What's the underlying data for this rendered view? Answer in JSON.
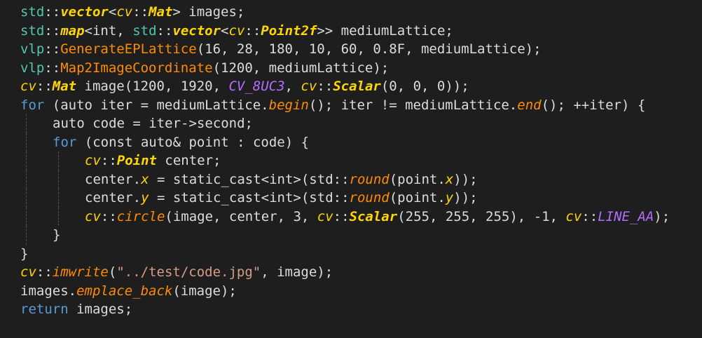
{
  "code_lines": [
    {
      "indent": 0,
      "tokens": [
        {
          "t": "std",
          "c": "ns"
        },
        {
          "t": "::",
          "c": "text"
        },
        {
          "t": "vector",
          "c": "type"
        },
        {
          "t": "<",
          "c": "text"
        },
        {
          "t": "cv",
          "c": "typedim"
        },
        {
          "t": "::",
          "c": "text"
        },
        {
          "t": "Mat",
          "c": "type"
        },
        {
          "t": "> images;",
          "c": "text"
        }
      ]
    },
    {
      "indent": 0,
      "tokens": [
        {
          "t": "std",
          "c": "ns"
        },
        {
          "t": "::",
          "c": "text"
        },
        {
          "t": "map",
          "c": "type"
        },
        {
          "t": "<int, ",
          "c": "text"
        },
        {
          "t": "std",
          "c": "ns"
        },
        {
          "t": "::",
          "c": "text"
        },
        {
          "t": "vector",
          "c": "type"
        },
        {
          "t": "<",
          "c": "text"
        },
        {
          "t": "cv",
          "c": "typedim"
        },
        {
          "t": "::",
          "c": "text"
        },
        {
          "t": "Point2f",
          "c": "type"
        },
        {
          "t": ">> mediumLattice;",
          "c": "text"
        }
      ]
    },
    {
      "indent": 0,
      "tokens": [
        {
          "t": "vlp",
          "c": "ns"
        },
        {
          "t": "::",
          "c": "text"
        },
        {
          "t": "GenerateEPLattice",
          "c": "fn"
        },
        {
          "t": "(16, 28, 180, 10, 60, 0.8F, mediumLattice);",
          "c": "text"
        }
      ]
    },
    {
      "indent": 0,
      "tokens": [
        {
          "t": "vlp",
          "c": "ns"
        },
        {
          "t": "::",
          "c": "text"
        },
        {
          "t": "Map2ImageCoordinate",
          "c": "fn"
        },
        {
          "t": "(1200, mediumLattice);",
          "c": "text"
        }
      ]
    },
    {
      "indent": 0,
      "tokens": [
        {
          "t": "cv",
          "c": "typedim"
        },
        {
          "t": "::",
          "c": "text"
        },
        {
          "t": "Mat",
          "c": "type"
        },
        {
          "t": " image(1200, 1920, ",
          "c": "text"
        },
        {
          "t": "CV_8UC3",
          "c": "macro"
        },
        {
          "t": ", ",
          "c": "text"
        },
        {
          "t": "cv",
          "c": "typedim"
        },
        {
          "t": "::",
          "c": "text"
        },
        {
          "t": "Scalar",
          "c": "type"
        },
        {
          "t": "(0, 0, 0));",
          "c": "text"
        }
      ]
    },
    {
      "indent": 0,
      "tokens": [
        {
          "t": "for",
          "c": "kw"
        },
        {
          "t": " (auto iter = mediumLattice.",
          "c": "text"
        },
        {
          "t": "begin",
          "c": "member"
        },
        {
          "t": "(); iter != mediumLattice.",
          "c": "text"
        },
        {
          "t": "end",
          "c": "member"
        },
        {
          "t": "(); ++iter) {",
          "c": "text"
        }
      ]
    },
    {
      "indent": 1,
      "tokens": [
        {
          "t": "auto code = iter->second;",
          "c": "text"
        }
      ]
    },
    {
      "indent": 1,
      "tokens": [
        {
          "t": "for",
          "c": "kw"
        },
        {
          "t": " (const auto& point : code) {",
          "c": "text"
        }
      ]
    },
    {
      "indent": 2,
      "tokens": [
        {
          "t": "cv",
          "c": "typedim"
        },
        {
          "t": "::",
          "c": "text"
        },
        {
          "t": "Point",
          "c": "type"
        },
        {
          "t": " center;",
          "c": "text"
        }
      ]
    },
    {
      "indent": 2,
      "tokens": [
        {
          "t": "center.",
          "c": "text"
        },
        {
          "t": "x",
          "c": "field"
        },
        {
          "t": " = static_cast<int>(std::",
          "c": "text"
        },
        {
          "t": "round",
          "c": "member"
        },
        {
          "t": "(point.",
          "c": "text"
        },
        {
          "t": "x",
          "c": "field"
        },
        {
          "t": "));",
          "c": "text"
        }
      ]
    },
    {
      "indent": 2,
      "tokens": [
        {
          "t": "center.",
          "c": "text"
        },
        {
          "t": "y",
          "c": "field"
        },
        {
          "t": " = static_cast<int>(std::",
          "c": "text"
        },
        {
          "t": "round",
          "c": "member"
        },
        {
          "t": "(point.",
          "c": "text"
        },
        {
          "t": "y",
          "c": "field"
        },
        {
          "t": "));",
          "c": "text"
        }
      ]
    },
    {
      "indent": 2,
      "tokens": [
        {
          "t": "cv",
          "c": "typedim"
        },
        {
          "t": "::",
          "c": "text"
        },
        {
          "t": "circle",
          "c": "member"
        },
        {
          "t": "(image, center, 3, ",
          "c": "text"
        },
        {
          "t": "cv",
          "c": "typedim"
        },
        {
          "t": "::",
          "c": "text"
        },
        {
          "t": "Scalar",
          "c": "type"
        },
        {
          "t": "(255, 255, 255), -1, ",
          "c": "text"
        },
        {
          "t": "cv",
          "c": "typedim"
        },
        {
          "t": "::",
          "c": "text"
        },
        {
          "t": "LINE_AA",
          "c": "macro"
        },
        {
          "t": ");",
          "c": "text"
        }
      ]
    },
    {
      "indent": 1,
      "tokens": [
        {
          "t": "}",
          "c": "text"
        }
      ]
    },
    {
      "indent": 0,
      "tokens": [
        {
          "t": "}",
          "c": "text"
        }
      ]
    },
    {
      "indent": 0,
      "tokens": [
        {
          "t": "cv",
          "c": "typedim"
        },
        {
          "t": "::",
          "c": "text"
        },
        {
          "t": "imwrite",
          "c": "member"
        },
        {
          "t": "(",
          "c": "text"
        },
        {
          "t": "\"../test/code.jpg\"",
          "c": "str"
        },
        {
          "t": ", image);",
          "c": "text"
        }
      ]
    },
    {
      "indent": 0,
      "tokens": [
        {
          "t": "images.",
          "c": "text"
        },
        {
          "t": "emplace_back",
          "c": "member"
        },
        {
          "t": "(image);",
          "c": "text"
        }
      ]
    },
    {
      "indent": 0,
      "tokens": [
        {
          "t": "return",
          "c": "kw"
        },
        {
          "t": " images;",
          "c": "text"
        }
      ]
    }
  ],
  "theme": {
    "background": "#1e1e1e",
    "text": "#dcdcdc",
    "keyword": "#569cd6",
    "namespace": "#4ec9b0",
    "function": "#ff8c00",
    "type": "#ffd700",
    "macro": "#b56cff",
    "string": "#d69d85"
  }
}
